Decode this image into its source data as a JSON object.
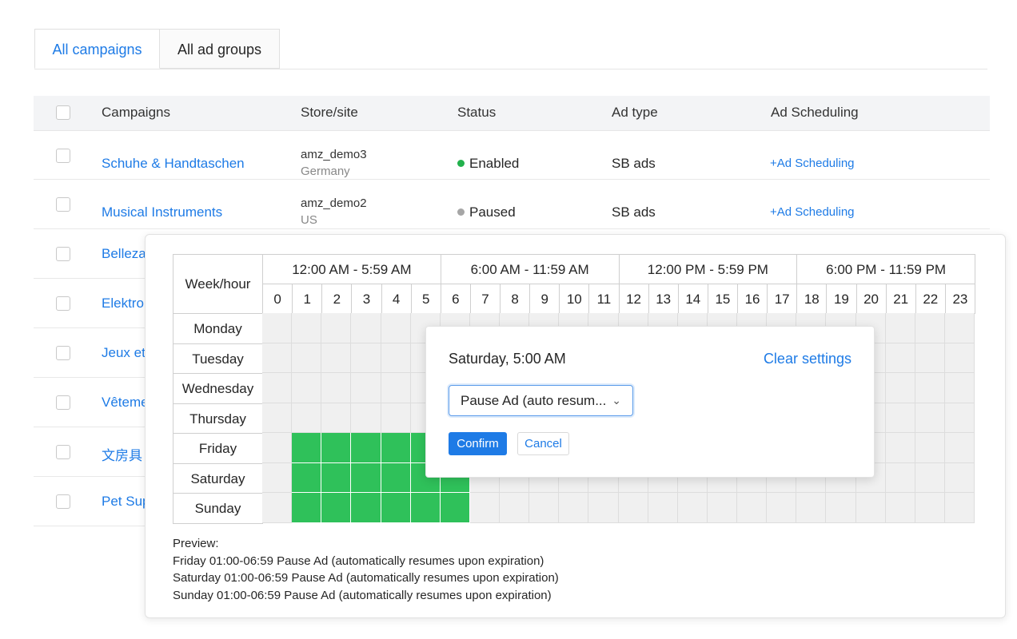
{
  "tabs": [
    {
      "label": "All campaigns",
      "active": true
    },
    {
      "label": "All ad groups",
      "active": false
    }
  ],
  "table": {
    "headers": {
      "campaigns": "Campaigns",
      "store": "Store/site",
      "status": "Status",
      "ad_type": "Ad type",
      "scheduling": "Ad Scheduling"
    },
    "rows": [
      {
        "name": "Schuhe & Handtaschen",
        "store": "amz_demo3",
        "country": "Germany",
        "status": "Enabled",
        "status_color": "#22b14c",
        "ad_type": "SB ads",
        "scheduling": "+Ad Scheduling"
      },
      {
        "name": "Musical Instruments",
        "store": "amz_demo2",
        "country": "US",
        "status": "Paused",
        "status_color": "#a6a6a6",
        "ad_type": "SB ads",
        "scheduling": "+Ad Scheduling"
      },
      {
        "name": "Belleza"
      },
      {
        "name": "Elektro"
      },
      {
        "name": "Jeux et"
      },
      {
        "name": "Vêteme"
      },
      {
        "name": "文房具"
      },
      {
        "name": "Pet Sup"
      }
    ]
  },
  "schedule": {
    "corner_label": "Week/hour",
    "ranges": [
      "12:00 AM - 5:59 AM",
      "6:00 AM - 11:59 AM",
      "12:00 PM - 5:59 PM",
      "6:00 PM - 11:59 PM"
    ],
    "hours": [
      "0",
      "1",
      "2",
      "3",
      "4",
      "5",
      "6",
      "7",
      "8",
      "9",
      "10",
      "11",
      "12",
      "13",
      "14",
      "15",
      "16",
      "17",
      "18",
      "19",
      "20",
      "21",
      "22",
      "23"
    ],
    "days": [
      "Monday",
      "Tuesday",
      "Wednesday",
      "Thursday",
      "Friday",
      "Saturday",
      "Sunday"
    ],
    "active_color": "#2fc15a",
    "active": {
      "Friday": [
        1,
        2,
        3,
        4,
        5,
        6
      ],
      "Saturday": [
        1,
        2,
        3,
        4,
        5,
        6
      ],
      "Sunday": [
        1,
        2,
        3,
        4,
        5,
        6
      ]
    }
  },
  "popover": {
    "title": "Saturday, 5:00 AM",
    "clear": "Clear settings",
    "select_value": "Pause Ad (auto resum...",
    "confirm": "Confirm",
    "cancel": "Cancel"
  },
  "preview": {
    "label": "Preview:",
    "lines": [
      "Friday 01:00-06:59 Pause Ad (automatically resumes upon expiration)",
      "Saturday 01:00-06:59 Pause Ad (automatically resumes upon expiration)",
      "Sunday 01:00-06:59 Pause Ad (automatically resumes upon expiration)"
    ]
  }
}
